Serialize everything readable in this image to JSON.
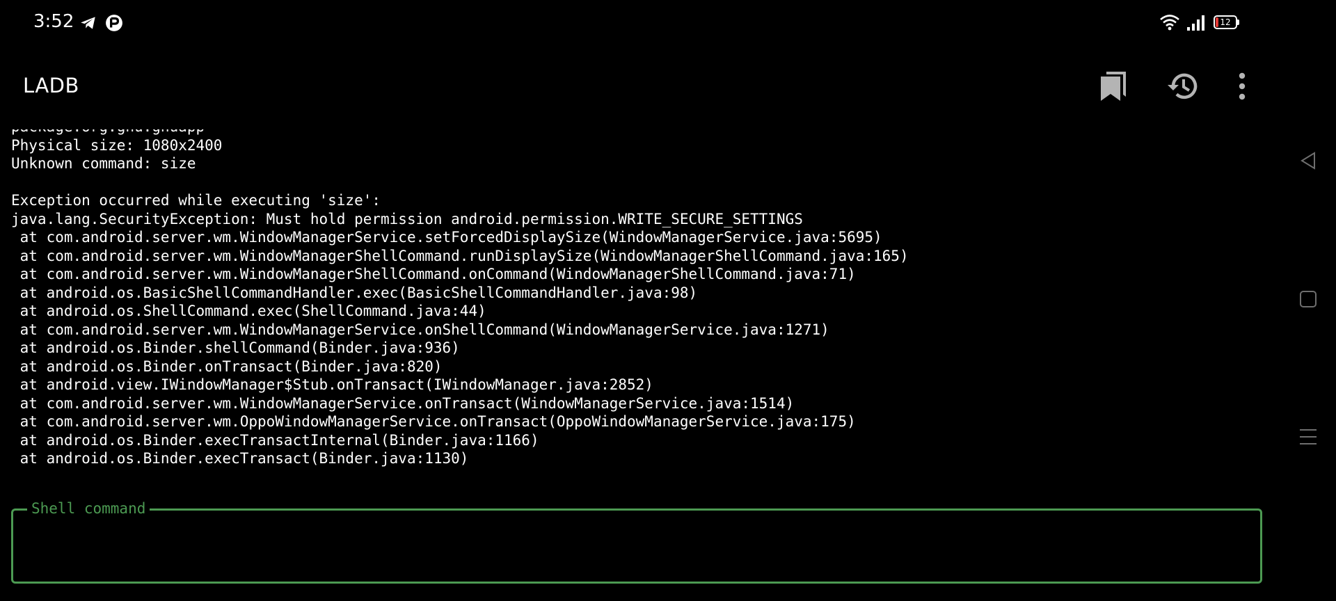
{
  "status_bar": {
    "time": "3:52",
    "left_icons": [
      "telegram-icon",
      "app-notification-icon"
    ],
    "right_icons": [
      "wifi-icon",
      "signal-icon",
      "battery-icon"
    ],
    "battery_level": "12",
    "battery_color": "#e53935"
  },
  "app_bar": {
    "title": "LADB",
    "actions": [
      "bookmarks-icon",
      "history-icon",
      "more-options-icon"
    ]
  },
  "output": {
    "lines": [
      "package:org.gnu.gnuapp",
      "Physical size: 1080x2400",
      "Unknown command: size",
      "",
      "Exception occurred while executing 'size':",
      "java.lang.SecurityException: Must hold permission android.permission.WRITE_SECURE_SETTINGS",
      " at com.android.server.wm.WindowManagerService.setForcedDisplaySize(WindowManagerService.java:5695)",
      " at com.android.server.wm.WindowManagerShellCommand.runDisplaySize(WindowManagerShellCommand.java:165)",
      " at com.android.server.wm.WindowManagerShellCommand.onCommand(WindowManagerShellCommand.java:71)",
      " at android.os.BasicShellCommandHandler.exec(BasicShellCommandHandler.java:98)",
      " at android.os.ShellCommand.exec(ShellCommand.java:44)",
      " at com.android.server.wm.WindowManagerService.onShellCommand(WindowManagerService.java:1271)",
      " at android.os.Binder.shellCommand(Binder.java:936)",
      " at android.os.Binder.onTransact(Binder.java:820)",
      " at android.view.IWindowManager$Stub.onTransact(IWindowManager.java:2852)",
      " at com.android.server.wm.WindowManagerService.onTransact(WindowManagerService.java:1514)",
      " at com.android.server.wm.OppoWindowManagerService.onTransact(OppoWindowManagerService.java:175)",
      " at android.os.Binder.execTransactInternal(Binder.java:1166)",
      " at android.os.Binder.execTransact(Binder.java:1130)"
    ]
  },
  "shell_input": {
    "label": "Shell command",
    "value": "",
    "accent_color": "#4c9a52"
  },
  "nav_bar": {
    "buttons": [
      "back-icon",
      "home-icon",
      "recents-icon"
    ]
  }
}
